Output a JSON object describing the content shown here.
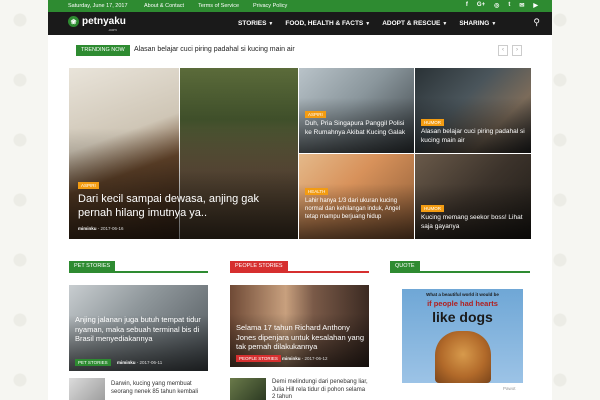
{
  "topbar": {
    "date": "Saturday, June 17, 2017",
    "links": [
      "About & Contact",
      "Terms of Service",
      "Privacy Policy"
    ],
    "social": [
      "f",
      "G+",
      "◎",
      "t",
      "✉",
      "▶"
    ]
  },
  "header": {
    "logo_text": "petnyaku",
    "logo_sub": ".com",
    "nav": [
      {
        "label": "STORIES",
        "has_caret": true
      },
      {
        "label": "FOOD, HEALTH & FACTS",
        "has_caret": true
      },
      {
        "label": "ADOPT & RESCUE",
        "has_caret": true
      },
      {
        "label": "SHARING",
        "has_caret": true
      }
    ],
    "caret": "▼",
    "search_glyph": "⚲"
  },
  "trending": {
    "label": "TRENDING NOW",
    "text": "Alasan belajar cuci piring padahal si kucing main air",
    "prev": "‹",
    "next": "›"
  },
  "hero": {
    "main": {
      "category": "Aspiri",
      "title": "Dari kecil sampai dewasa, anjing gak pernah hilang imutnya ya..",
      "author": "miminku",
      "date": "2017-06-16"
    },
    "tiles": [
      {
        "category": "Aspiri",
        "title": "Duh, Pria Singapura Panggil Polisi ke Rumahnya Akibat Kucing Galak"
      },
      {
        "category": "Humor",
        "title": "Alasan belajar cuci piring padahal si kucing main air"
      },
      {
        "category": "Health",
        "title": "Lahir hanya 1/3 dari ukuran kucing normal dan kehilangan induk, Angel tetap mampu berjuang hidup"
      },
      {
        "category": "Humor",
        "title": "Kucing memang seekor boss! Lihat saja gayanya"
      }
    ]
  },
  "sections": {
    "pet_stories": {
      "label": "PET STORIES",
      "feature_title": "Anjing jalanan juga butuh tempat tidur nyaman, maka sebuah terminal bis di Brasil menyediakannya",
      "feature_category": "Pet Stories",
      "feature_author": "miminku",
      "feature_date": "2017-06-11",
      "item_text": "Darwin, kucing yang membuat seorang nenek 85 tahun kembali"
    },
    "people_stories": {
      "label": "PEOPLE STORIES",
      "feature_title": "Selama 17 tahun Richard Anthony Jones dipenjara untuk kesalahan yang tak pernah dilakukannya",
      "feature_category": "People Stories",
      "feature_author": "miminku",
      "feature_date": "2017-06-12",
      "item_text": "Demi melindungi dari penebang liar, Julia Hill rela tidur di pohon selama 2 tahun"
    },
    "quote": {
      "label": "QUOTE",
      "quote_line1": "What a beautiful world it would be",
      "quote_line2": "if people had hearts",
      "quote_line3": "like dogs",
      "credit": "Pawot"
    }
  },
  "colors": {
    "brand_green": "#2e8b31",
    "pet_tag": "#2e8b31",
    "people_tag": "#d62f2f",
    "category": "#f39c12"
  }
}
